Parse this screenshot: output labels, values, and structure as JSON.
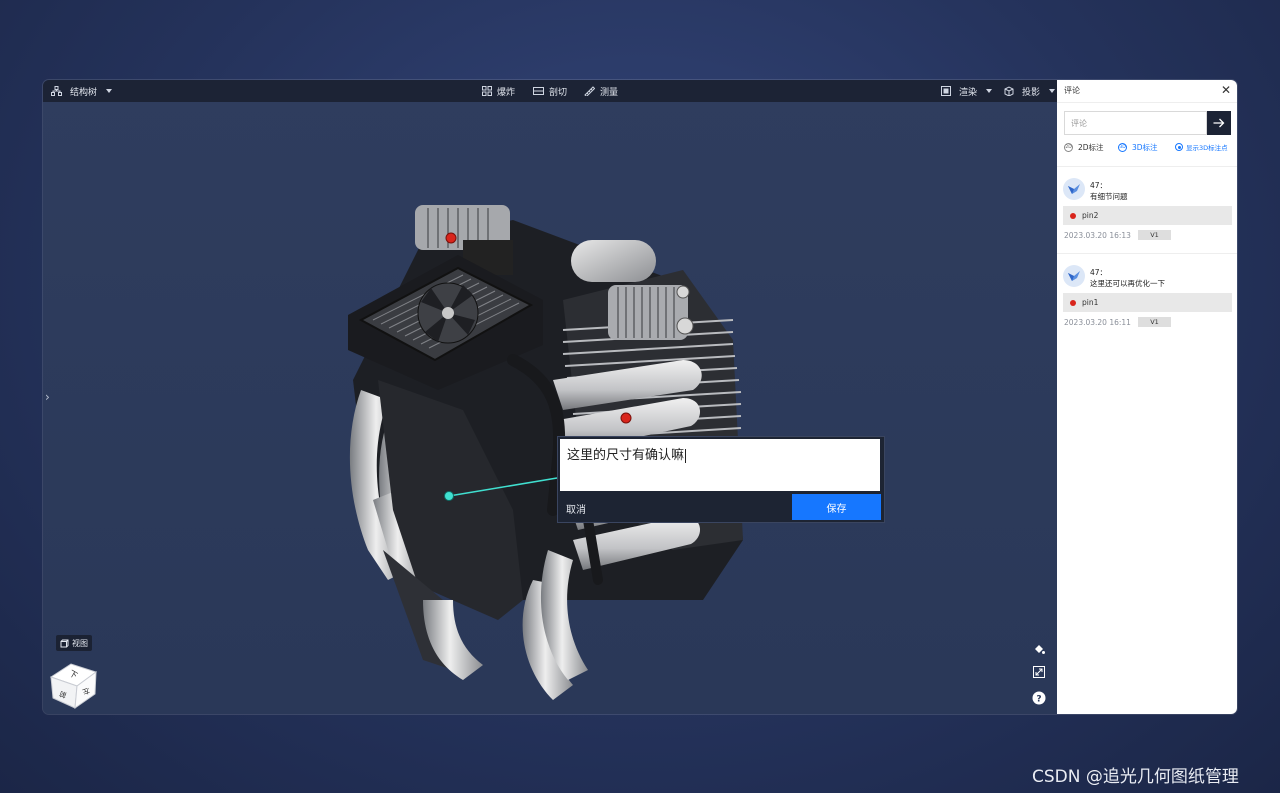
{
  "toolbar": {
    "structure_tree": "结构树",
    "explode": "爆炸",
    "section": "剖切",
    "measure": "测量",
    "render": "渲染",
    "projection": "投影"
  },
  "viewer": {
    "view_label": "视图",
    "cube_faces": {
      "top": "下",
      "left": "前",
      "right": "左"
    }
  },
  "comment_popup": {
    "text": "这里的尺寸有确认嘛",
    "cancel": "取消",
    "save": "保存"
  },
  "panel": {
    "title": "评论",
    "search_placeholder": "评论",
    "option_2d": "2D标注",
    "option_3d": "3D标注",
    "show_3d_points": "显示3D标注点",
    "comments": [
      {
        "user": "47：",
        "text": "有细节问题",
        "pin": "pin2",
        "time": "2023.03.20 16:13",
        "version": "V1"
      },
      {
        "user": "47：",
        "text": "这里还可以再优化一下",
        "pin": "pin1",
        "time": "2023.03.20 16:11",
        "version": "V1"
      }
    ]
  },
  "watermark": "CSDN @追光几何图纸管理",
  "colors": {
    "accent": "#1677ff",
    "toolbar": "#1c2335",
    "pin": "#d9251c",
    "leader": "#40e0d0"
  }
}
